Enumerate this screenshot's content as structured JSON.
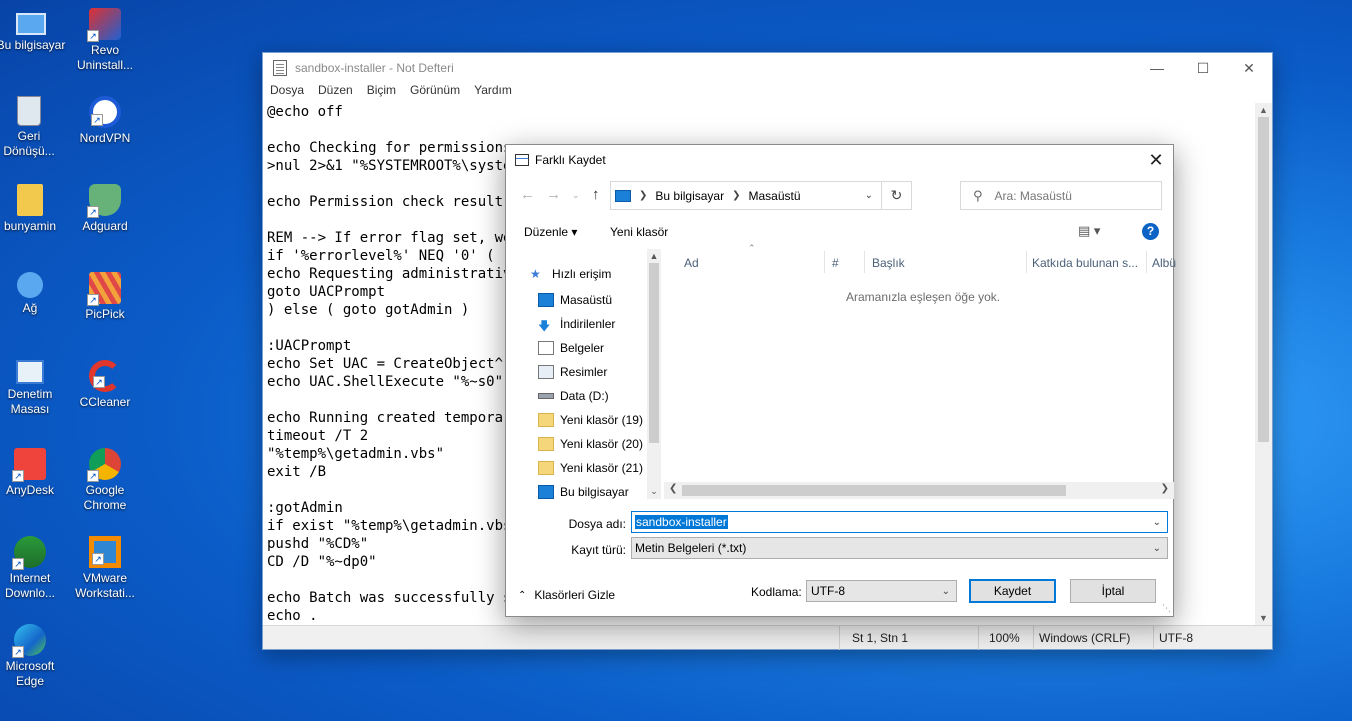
{
  "desktop": {
    "icons": [
      {
        "label": "Bu bilgisayar"
      },
      {
        "label": "Revo Uninstall..."
      },
      {
        "label": "Geri Dönüşü..."
      },
      {
        "label": "NordVPN"
      },
      {
        "label": "bunyamin"
      },
      {
        "label": "Adguard"
      },
      {
        "label": "Ağ"
      },
      {
        "label": "PicPick"
      },
      {
        "label": "Denetim Masası"
      },
      {
        "label": "CCleaner"
      },
      {
        "label": "AnyDesk"
      },
      {
        "label": "Google Chrome"
      },
      {
        "label": "Internet Downlo..."
      },
      {
        "label": "VMware Workstati..."
      },
      {
        "label": "Microsoft Edge"
      }
    ]
  },
  "notepad": {
    "title": "sandbox-installer - Not Defteri",
    "menu": [
      "Dosya",
      "Düzen",
      "Biçim",
      "Görünüm",
      "Yardım"
    ],
    "lines": [
      "@echo off",
      "",
      "echo Checking for permissions",
      ">nul 2>&1 \"%SYSTEMROOT%\\system",
      "",
      "echo Permission check result:",
      "",
      "REM --> If error flag set, we",
      "if '%errorlevel%' NEQ '0' (",
      "echo Requesting administrative",
      "goto UACPrompt",
      ") else ( goto gotAdmin )",
      "",
      ":UACPrompt",
      "echo Set UAC = CreateObject^(\"",
      "echo UAC.ShellExecute \"%~s0\",",
      "",
      "echo Running created temporary",
      "timeout /T 2",
      "\"%temp%\\getadmin.vbs\"",
      "exit /B",
      "",
      ":gotAdmin",
      "if exist \"%temp%\\getadmin.vbs\"",
      "pushd \"%CD%\"",
      "CD /D \"%~dp0\"",
      "",
      "echo Batch was successfully st",
      "echo ."
    ],
    "status": {
      "position": "St 1, Stn 1",
      "zoom": "100%",
      "line_ending": "Windows (CRLF)",
      "encoding": "UTF-8"
    }
  },
  "dialog": {
    "title": "Farklı Kaydet",
    "breadcrumb": [
      "Bu bilgisayar",
      "Masaüstü"
    ],
    "search_placeholder": "Ara: Masaüstü",
    "toolbar": {
      "organize": "Düzenle ▾",
      "new_folder": "Yeni klasör"
    },
    "nav": [
      {
        "label": "Hızlı erişim",
        "icon": "star-icon",
        "pinned": false
      },
      {
        "label": "Masaüstü",
        "icon": "desktop-icon",
        "pinned": true
      },
      {
        "label": "İndirilenler",
        "icon": "download-icon",
        "pinned": true
      },
      {
        "label": "Belgeler",
        "icon": "document-icon",
        "pinned": true
      },
      {
        "label": "Resimler",
        "icon": "picture-icon",
        "pinned": true
      },
      {
        "label": "Data (D:)",
        "icon": "drive-icon",
        "pinned": false
      },
      {
        "label": "Yeni klasör (19)",
        "icon": "folder-icon",
        "pinned": false
      },
      {
        "label": "Yeni klasör (20)",
        "icon": "folder-icon",
        "pinned": false
      },
      {
        "label": "Yeni klasör (21)",
        "icon": "folder-icon",
        "pinned": false
      },
      {
        "label": "Bu bilgisayar",
        "icon": "computer-icon",
        "pinned": false
      }
    ],
    "columns": [
      "Ad",
      "#",
      "Başlık",
      "Katkıda bulunan s...",
      "Albü"
    ],
    "empty_message": "Aramanızla eşleşen öğe yok.",
    "filename_label": "Dosya adı:",
    "filename_value": "sandbox-installer",
    "filetype_label": "Kayıt türü:",
    "filetype_value": "Metin Belgeleri (*.txt)",
    "hide_folders": "Klasörleri Gizle",
    "encoding_label": "Kodlama:",
    "encoding_value": "UTF-8",
    "save_button": "Kaydet",
    "cancel_button": "İptal",
    "accent_color": "#0078d7"
  }
}
